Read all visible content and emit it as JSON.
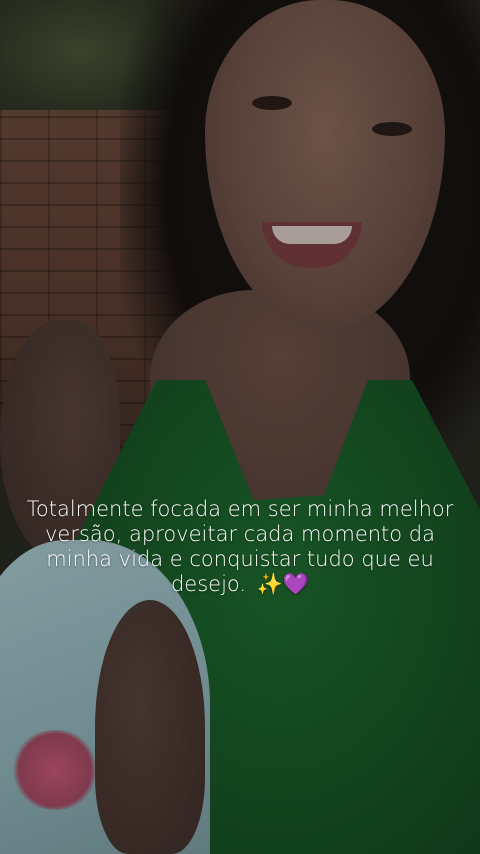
{
  "story": {
    "caption": "Totalmente focada em ser minha melhor versão, aproveitar cada momento da minha vida e conquistar tudo que eu desejo.",
    "caption_emoji": "✨💜",
    "colors": {
      "text": "#ffffff",
      "shirt": "#1f6b30",
      "heart": "#8a3fd1"
    }
  }
}
